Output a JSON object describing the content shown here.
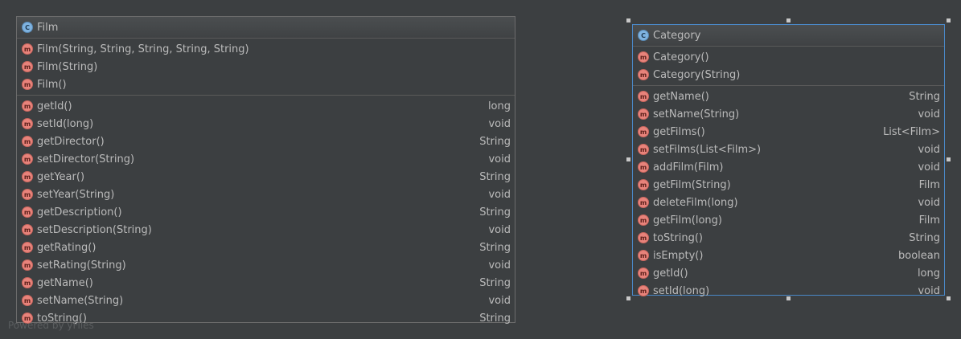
{
  "film": {
    "name": "Film",
    "constructors": [
      {
        "sig": "Film(String, String, String, String, String)"
      },
      {
        "sig": "Film(String)"
      },
      {
        "sig": "Film()"
      }
    ],
    "methods": [
      {
        "sig": "getId()",
        "type": "long"
      },
      {
        "sig": "setId(long)",
        "type": "void"
      },
      {
        "sig": "getDirector()",
        "type": "String"
      },
      {
        "sig": "setDirector(String)",
        "type": "void"
      },
      {
        "sig": "getYear()",
        "type": "String"
      },
      {
        "sig": "setYear(String)",
        "type": "void"
      },
      {
        "sig": "getDescription()",
        "type": "String"
      },
      {
        "sig": "setDescription(String)",
        "type": "void"
      },
      {
        "sig": "getRating()",
        "type": "String"
      },
      {
        "sig": "setRating(String)",
        "type": "void"
      },
      {
        "sig": "getName()",
        "type": "String"
      },
      {
        "sig": "setName(String)",
        "type": "void"
      },
      {
        "sig": "toString()",
        "type": "String"
      }
    ]
  },
  "category": {
    "name": "Category",
    "constructors": [
      {
        "sig": "Category()"
      },
      {
        "sig": "Category(String)"
      }
    ],
    "methods": [
      {
        "sig": "getName()",
        "type": "String"
      },
      {
        "sig": "setName(String)",
        "type": "void"
      },
      {
        "sig": "getFilms()",
        "type": "List<Film>"
      },
      {
        "sig": "setFilms(List<Film>)",
        "type": "void"
      },
      {
        "sig": "addFilm(Film)",
        "type": "void"
      },
      {
        "sig": "getFilm(String)",
        "type": "Film"
      },
      {
        "sig": "deleteFilm(long)",
        "type": "void"
      },
      {
        "sig": "getFilm(long)",
        "type": "Film"
      },
      {
        "sig": "toString()",
        "type": "String"
      },
      {
        "sig": "isEmpty()",
        "type": "boolean"
      },
      {
        "sig": "getId()",
        "type": "long"
      },
      {
        "sig": "setId(long)",
        "type": "void"
      }
    ]
  },
  "icons": {
    "class_glyph": "C",
    "method_glyph": "m",
    "class_icon": "class-icon",
    "method_icon": "method-icon"
  },
  "watermark": "Powered by yFiles",
  "colors": {
    "background": "#3c3f41",
    "text": "#bbbbbb",
    "selection": "#4a88c7",
    "method_icon": "#e8837b",
    "class_icon": "#7fb3e0"
  }
}
